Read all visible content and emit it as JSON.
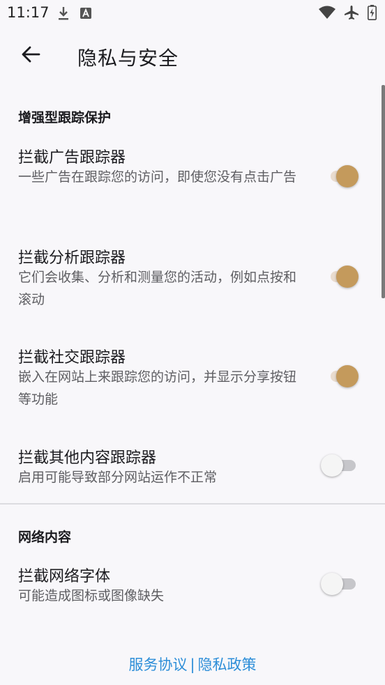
{
  "status_bar": {
    "time": "11:17",
    "icons_left": [
      "download-icon",
      "font-app-icon"
    ],
    "icons_right": [
      "wifi-icon",
      "airplane-mode-icon",
      "battery-charging-icon"
    ]
  },
  "app_bar": {
    "back_icon": "arrow-back-icon",
    "title": "隐私与安全"
  },
  "sections": [
    {
      "header": "增强型跟踪保护",
      "items": [
        {
          "title": "拦截广告跟踪器",
          "summary": "一些广告在跟踪您的访问，即使您没有点击广告",
          "enabled": true
        },
        {
          "title": "拦截分析跟踪器",
          "summary": "它们会收集、分析和测量您的活动，例如点按和滚动",
          "enabled": true
        },
        {
          "title": "拦截社交跟踪器",
          "summary": "嵌入在网站上来跟踪您的访问，并显示分享按钮等功能",
          "enabled": true
        },
        {
          "title": "拦截其他内容跟踪器",
          "summary": "启用可能导致部分网站运作不正常",
          "enabled": false
        }
      ]
    },
    {
      "header": "网络内容",
      "items": [
        {
          "title": "拦截网络字体",
          "summary": "可能造成图标或图像缺失",
          "enabled": false
        }
      ]
    }
  ],
  "footer": {
    "terms_link": "服务协议",
    "separator": "|",
    "privacy_link": "隐私政策"
  },
  "colors": {
    "background": "#f8f7fa",
    "switch_on_thumb": "#c49a5c",
    "switch_on_track": "#e9dccf",
    "link": "#2d8ed8"
  }
}
